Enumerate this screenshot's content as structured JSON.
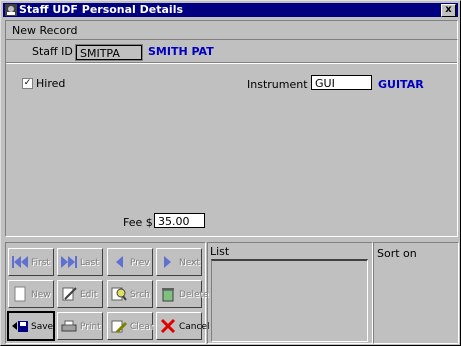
{
  "window": {
    "title": "Staff UDF Personal Details",
    "close_glyph": "x"
  },
  "header": {
    "label": "New Record"
  },
  "staff": {
    "label": "Staff ID »",
    "id_value": "SMITPA",
    "name": "SMITH PAT"
  },
  "hired": {
    "label": "Hired",
    "checked": true
  },
  "instrument": {
    "label": "Instrument »",
    "value": "GUI",
    "name": "GUITAR"
  },
  "fee": {
    "label": "Fee $",
    "value": "35.00"
  },
  "toolbar": {
    "first": "First",
    "last": "Last",
    "prev": "Prev",
    "next": "Next",
    "new": "New",
    "edit": "Edit",
    "srch": "Srch",
    "delete": "Delete",
    "save": "Save",
    "print": "Print",
    "clear": "Clear",
    "cancel": "Cancel"
  },
  "list": {
    "label": "List"
  },
  "sort": {
    "label": "Sort on"
  },
  "colors": {
    "title_bar": "#000080",
    "link_blue": "#0000c0",
    "face": "#c0c0c0"
  }
}
